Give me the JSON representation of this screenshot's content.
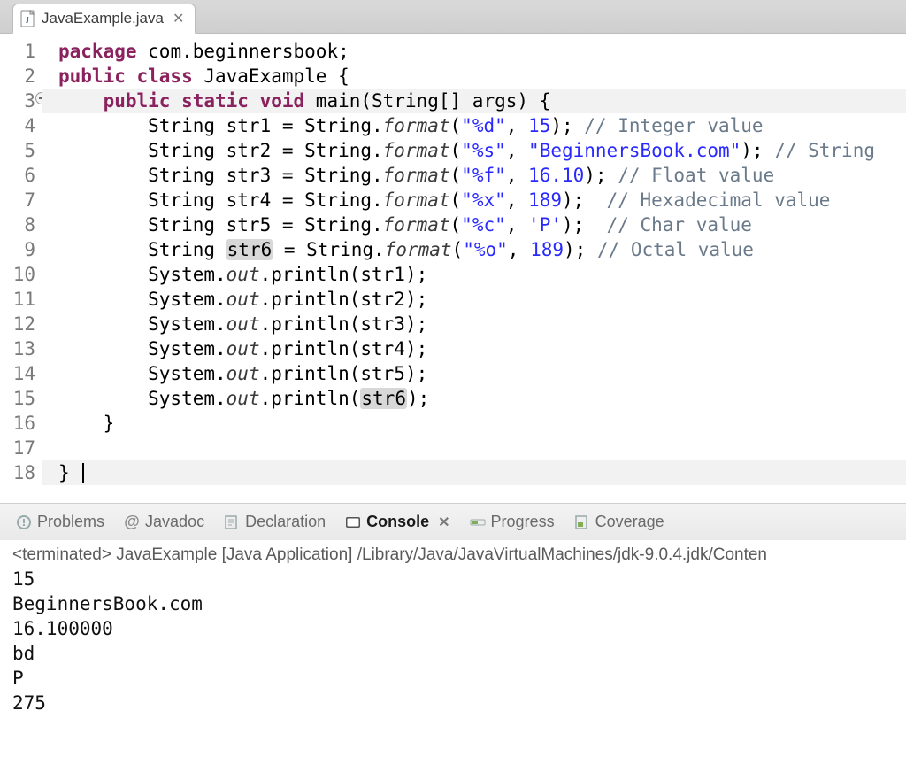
{
  "tab": {
    "filename": "JavaExample.java",
    "close_glyph": "✕"
  },
  "gutter_lines": [
    "1",
    "2",
    "3",
    "4",
    "5",
    "6",
    "7",
    "8",
    "9",
    "10",
    "11",
    "12",
    "13",
    "14",
    "15",
    "16",
    "17",
    "18"
  ],
  "fold_line_index": 2,
  "highlight_lines": [
    2,
    17
  ],
  "highlight_tokens": [
    "str6",
    "str6"
  ],
  "code": {
    "package_kw": "package",
    "package_name": "com.beginnersbook",
    "class_decl_kw": "public class",
    "class_name": "JavaExample",
    "main_kw": "public static void",
    "main_name": "main",
    "main_params": "(String[] args) {",
    "vars": [
      {
        "name": "str1",
        "fmt": "\"%d\"",
        "arg": "15",
        "comment": "// Integer value"
      },
      {
        "name": "str2",
        "fmt": "\"%s\"",
        "arg": "\"BeginnersBook.com\"",
        "comment": "// String"
      },
      {
        "name": "str3",
        "fmt": "\"%f\"",
        "arg": "16.10",
        "comment": "// Float value"
      },
      {
        "name": "str4",
        "fmt": "\"%x\"",
        "arg": "189",
        "comment": "// Hexadecimal value",
        "extra_space": true
      },
      {
        "name": "str5",
        "fmt": "\"%c\"",
        "arg": "'P'",
        "comment": "// Char value",
        "extra_space": true
      },
      {
        "name": "str6",
        "fmt": "\"%o\"",
        "arg": "189",
        "comment": "// Octal value"
      }
    ],
    "string_type": "String",
    "format_owner": "String",
    "format_method": "format",
    "print_owner": "System",
    "print_field": "out",
    "print_method": "println",
    "prints": [
      "str1",
      "str2",
      "str3",
      "str4",
      "str5",
      "str6"
    ]
  },
  "views": [
    {
      "id": "problems",
      "label": "Problems",
      "active": false
    },
    {
      "id": "javadoc",
      "label": "Javadoc",
      "active": false,
      "prefix": "@"
    },
    {
      "id": "declaration",
      "label": "Declaration",
      "active": false
    },
    {
      "id": "console",
      "label": "Console",
      "active": true
    },
    {
      "id": "progress",
      "label": "Progress",
      "active": false
    },
    {
      "id": "coverage",
      "label": "Coverage",
      "active": false
    }
  ],
  "console": {
    "header": "<terminated> JavaExample [Java Application] /Library/Java/JavaVirtualMachines/jdk-9.0.4.jdk/Conten",
    "output": "15\nBeginnersBook.com\n16.100000\nbd\nP\n275"
  }
}
